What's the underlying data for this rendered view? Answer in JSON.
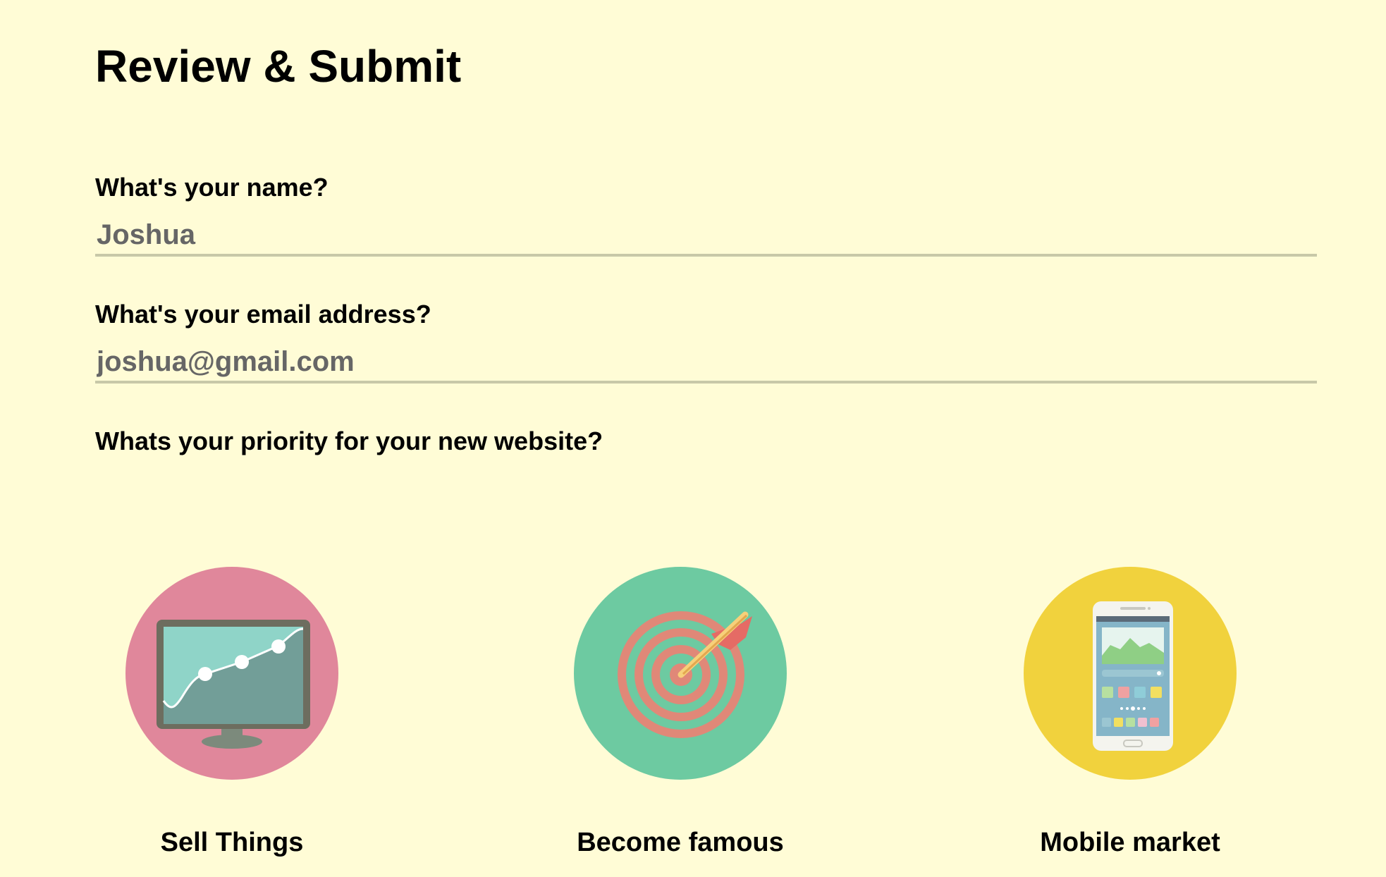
{
  "title": "Review & Submit",
  "name_field": {
    "label": "What's your name?",
    "value": "Joshua"
  },
  "email_field": {
    "label": "What's your email address?",
    "value": "joshua@gmail.com"
  },
  "priority": {
    "label": "Whats your priority for your new website?",
    "options": [
      {
        "label": "Sell Things",
        "icon": "monitor-chart-icon",
        "color": "#e0879b"
      },
      {
        "label": "Become famous",
        "icon": "target-arrow-icon",
        "color": "#6dcaa1"
      },
      {
        "label": "Mobile market",
        "icon": "smartphone-icon",
        "color": "#f1d23d"
      }
    ]
  },
  "colors": {
    "background": "#fffcd6",
    "input_underline": "#c8c8a8",
    "input_text": "#666666"
  }
}
